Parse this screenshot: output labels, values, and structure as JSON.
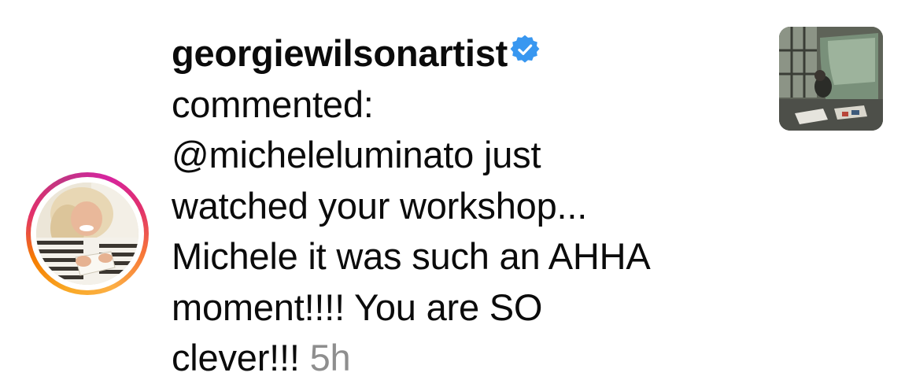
{
  "notification": {
    "username": "georgiewilsonartist",
    "verified": true,
    "action": "commented:",
    "comment_lines": [
      "@micheleluminato just",
      "watched your workshop...",
      "Michele it was such an AHHA",
      "moment!!!! You are SO",
      "clever!!!"
    ],
    "timestamp": "5h"
  },
  "icons": {
    "verified": "verified-badge-icon"
  },
  "colors": {
    "text": "#0b0b0b",
    "timestamp": "#8e8e8e",
    "verified_blue": "#3897f0",
    "story_ring": [
      "#fcaf45",
      "#f77737",
      "#e1306c",
      "#c13584"
    ]
  }
}
